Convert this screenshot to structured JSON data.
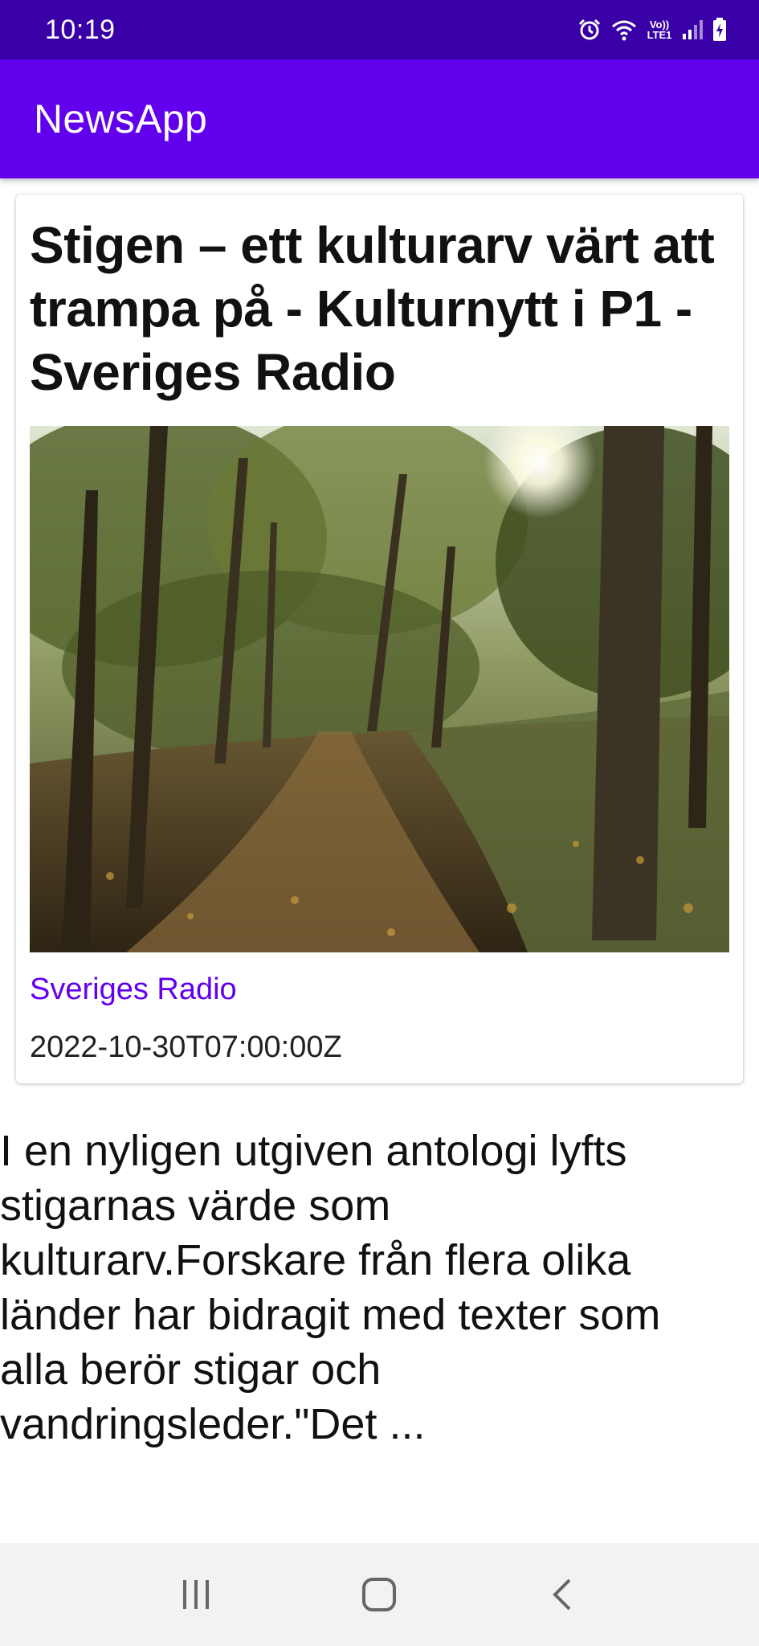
{
  "status_bar": {
    "time": "10:19",
    "network_label": "Vo)) LTE1",
    "icons": [
      "alarm-icon",
      "wifi-icon",
      "volte-icon",
      "signal-icon",
      "battery-charging-icon"
    ]
  },
  "app_bar": {
    "title": "NewsApp"
  },
  "article": {
    "headline": "Stigen – ett kulturarv värt att trampa på - Kulturnytt i P1 - Sveriges Radio",
    "image": "forest-path-photo",
    "source": "Sveriges Radio",
    "published": "2022-10-30T07:00:00Z",
    "description": "I en nyligen utgiven antologi lyfts stigarnas värde som kulturarv.Forskare från flera olika länder har bidragit med texter som alla berör stigar och vandringsleder.\"Det ..."
  },
  "navigation": {
    "buttons": [
      "recent-apps-icon",
      "home-icon",
      "back-icon"
    ]
  },
  "colors": {
    "status_bar": "#3a00a8",
    "app_bar": "#6200ee",
    "accent_text": "#6200ee",
    "nav_bar": "#f2f2f2"
  }
}
